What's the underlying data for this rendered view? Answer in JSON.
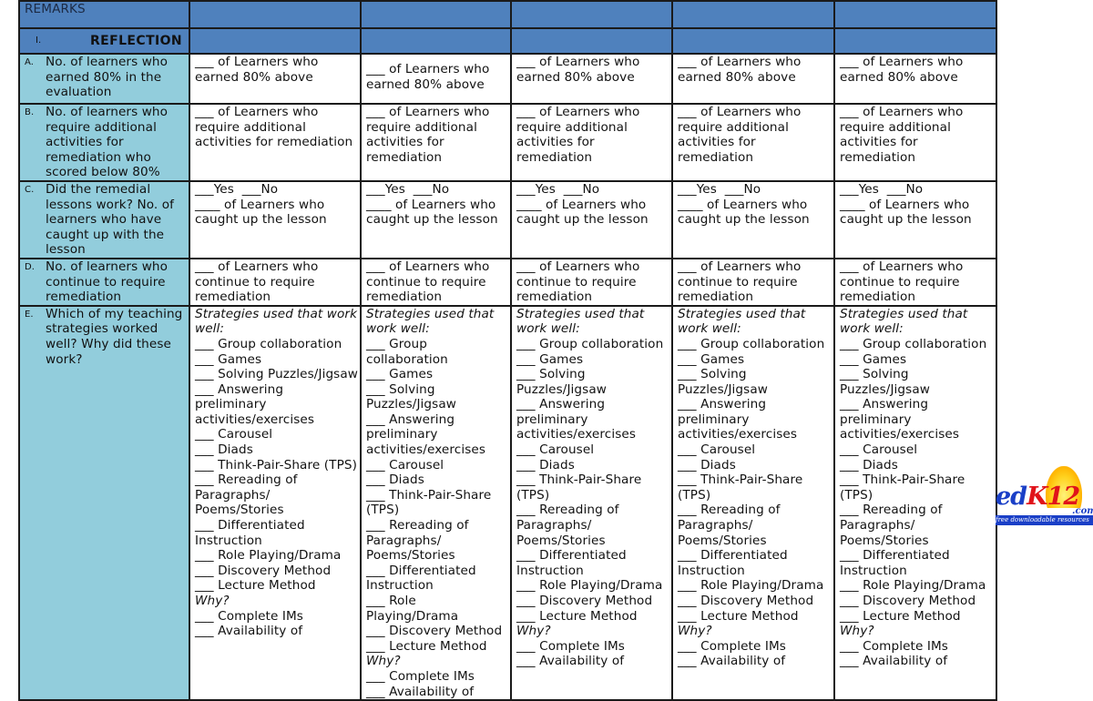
{
  "header": {
    "remarks_label": "REMARKS",
    "section_number": "I.",
    "section_title": "REFLECTION",
    "day_columns": [
      "",
      "",
      "",
      "",
      ""
    ]
  },
  "rows": [
    {
      "letter": "A.",
      "question": "No. of learners who earned 80% in the evaluation",
      "answers": [
        "___ of Learners who earned 80% above",
        "___ of Learners who earned 80% above",
        "___ of Learners who earned 80% above",
        "___ of Learners who earned 80% above",
        "___ of Learners who earned 80% above"
      ]
    },
    {
      "letter": "B.",
      "question": "No. of learners who require additional activities for remediation who scored below 80%",
      "answers": [
        "___ of Learners who require additional activities for remediation",
        "___ of Learners who require additional activities for remediation",
        "___ of Learners who require additional activities for remediation",
        "___ of Learners who require additional activities for remediation",
        "___ of Learners who require additional activities for remediation"
      ]
    },
    {
      "letter": "C.",
      "question": "Did the remedial lessons work? No. of learners who have caught up with the lesson",
      "answer_line1": "___Yes  ___No",
      "answer_line2": "____ of Learners who caught up the lesson"
    },
    {
      "letter": "D.",
      "question": "No. of learners who continue to require remediation",
      "answers": [
        "___  of Learners who continue to require remediation",
        "___  of Learners who continue to require remediation",
        "___  of Learners who continue to require remediation",
        "___  of Learners who continue to require remediation",
        "___  of Learners who continue to require remediation"
      ]
    },
    {
      "letter": "E.",
      "question": "Which of my teaching strategies worked well? Why did these work?",
      "strategies_heading": "Strategies used that work well:",
      "strategies": [
        "___ Group collaboration",
        "___ Games",
        "___ Solving Puzzles/Jigsaw",
        "___ Answering preliminary activities/exercises",
        "___ Carousel",
        "___ Diads",
        "___ Think-Pair-Share (TPS)",
        "___ Rereading of Paragraphs/ Poems/Stories",
        "___ Differentiated Instruction",
        "___ Role Playing/Drama",
        "___ Discovery Method",
        "___ Lecture Method"
      ],
      "why_heading": "Why?",
      "why_items": [
        "___ Complete IMs",
        "___ Availability of"
      ]
    }
  ],
  "logo": {
    "brand_ed": "ed",
    "brand_k12": "K12",
    "domain": ".com",
    "tagline": "free downloadable resources"
  }
}
